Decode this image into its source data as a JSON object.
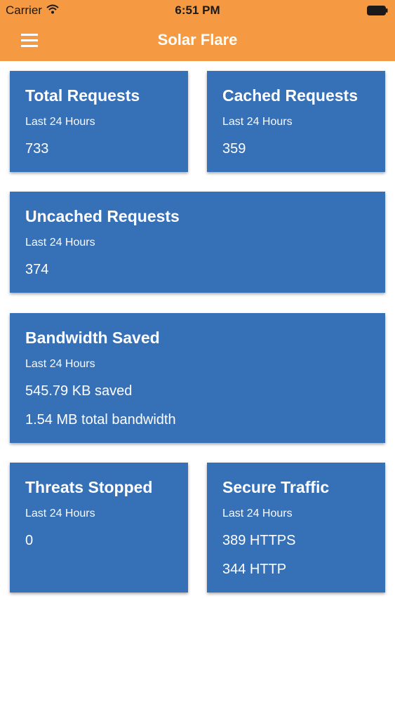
{
  "status_bar": {
    "carrier": "Carrier",
    "time": "6:51 PM"
  },
  "app_bar": {
    "title": "Solar Flare"
  },
  "cards": {
    "total_requests": {
      "title": "Total Requests",
      "subtitle": "Last 24 Hours",
      "value": "733"
    },
    "cached_requests": {
      "title": "Cached Requests",
      "subtitle": "Last 24 Hours",
      "value": "359"
    },
    "uncached_requests": {
      "title": "Uncached Requests",
      "subtitle": "Last 24 Hours",
      "value": "374"
    },
    "bandwidth_saved": {
      "title": "Bandwidth Saved",
      "subtitle": "Last 24 Hours",
      "value": "545.79 KB saved",
      "value2": "1.54 MB total bandwidth"
    },
    "threats_stopped": {
      "title": "Threats Stopped",
      "subtitle": "Last 24 Hours",
      "value": "0"
    },
    "secure_traffic": {
      "title": "Secure Traffic",
      "subtitle": "Last 24 Hours",
      "value": "389 HTTPS",
      "value2": "344 HTTP"
    }
  },
  "colors": {
    "header": "#f59a42",
    "card": "#3670b7",
    "text_on_card": "#ffffff"
  },
  "icons": [
    "wifi-icon",
    "battery-icon",
    "menu-icon"
  ]
}
